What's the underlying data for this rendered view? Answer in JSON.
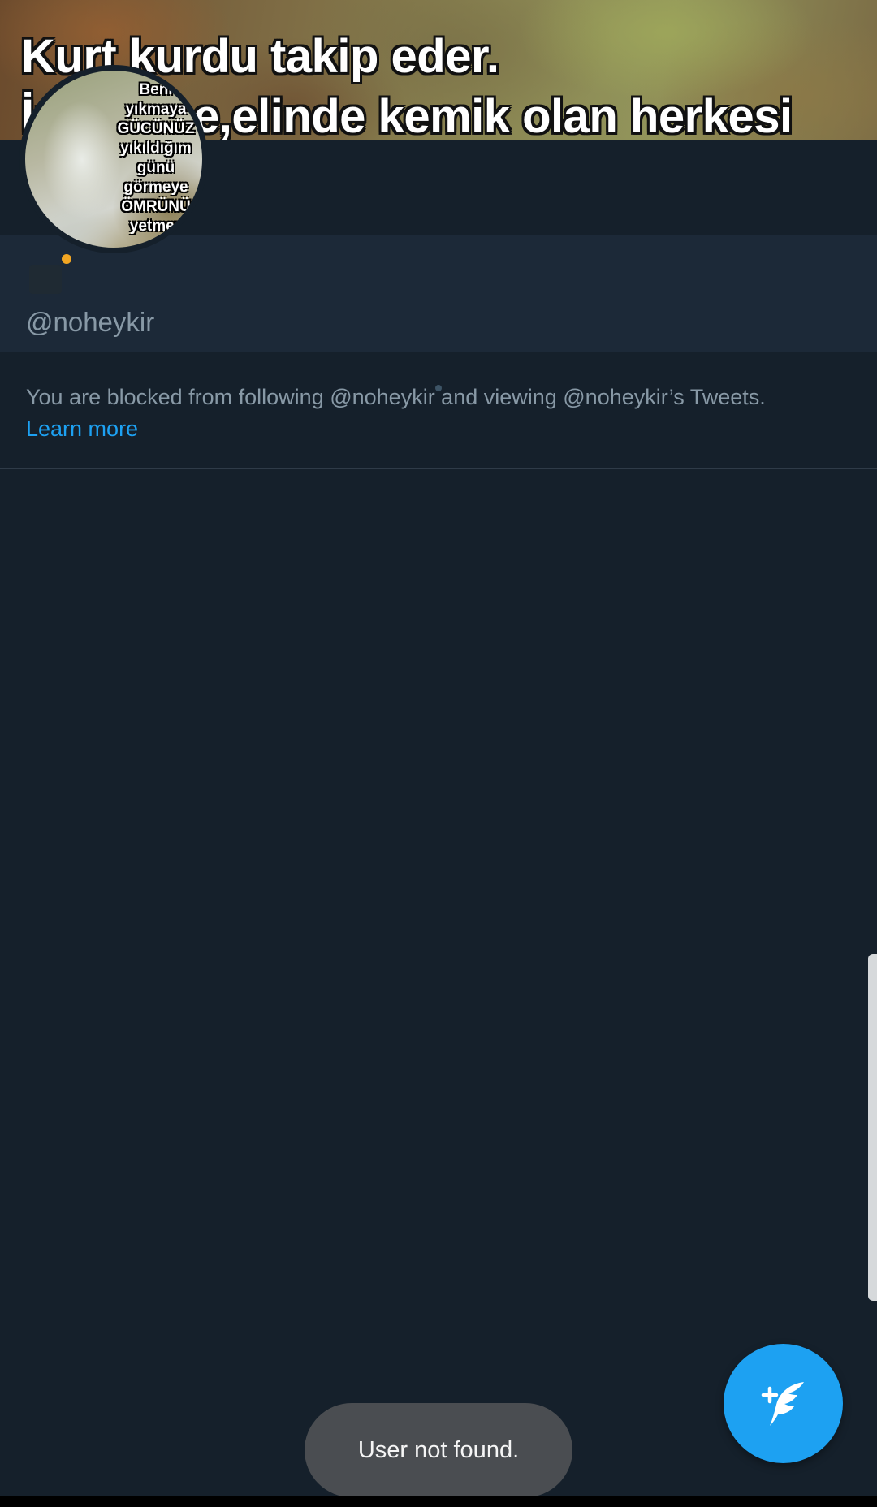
{
  "banner": {
    "line1": "Kurt kurdu takip eder.",
    "line2": "İnsan ise,elinde kemik olan herkesi"
  },
  "avatar": {
    "lines": [
      "Beni",
      "yıkmaya",
      "GÜCÜNÜZ",
      "yıkıldığım",
      "günü",
      "görmeye",
      "ÖMRÜNÜ",
      "yetmez"
    ]
  },
  "profile": {
    "handle": "@noheykir"
  },
  "blocked_notice": {
    "text": "You are blocked from following @noheykir and viewing @noheykir’s Tweets.",
    "link": "Learn more"
  },
  "fab": {
    "icon": "compose-tweet-icon"
  },
  "toast": {
    "message": "User not found."
  },
  "colors": {
    "background": "#15202b",
    "info_band": "#1c2938",
    "secondary_text": "#8899a6",
    "accent": "#1da1f2",
    "toast_bg": "#4a4d51"
  }
}
